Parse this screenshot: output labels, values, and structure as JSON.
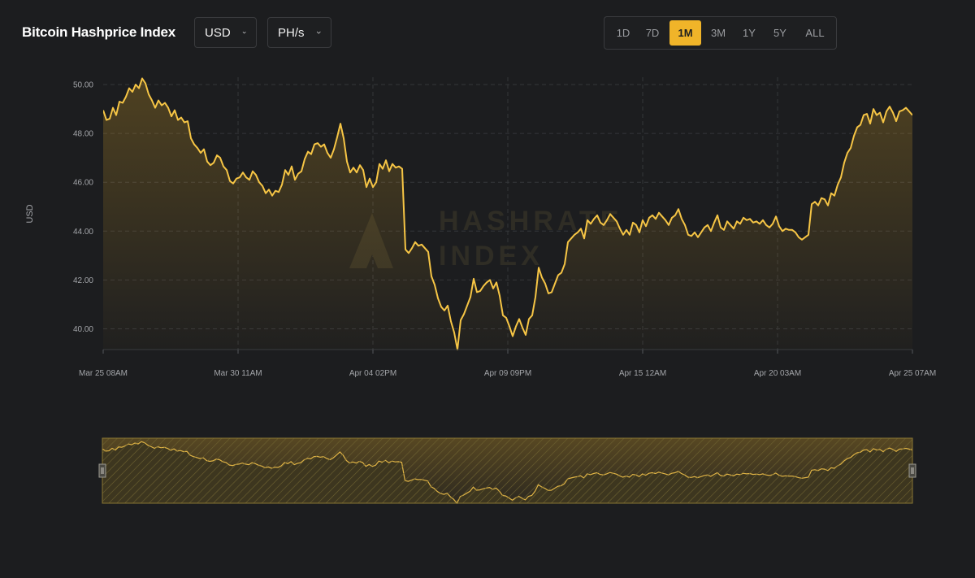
{
  "header": {
    "title": "Bitcoin Hashprice Index",
    "currency": "USD",
    "unit": "PH/s",
    "ranges": [
      "1D",
      "7D",
      "1M",
      "3M",
      "1Y",
      "5Y",
      "ALL"
    ],
    "active_range": "1M"
  },
  "watermark": {
    "line1": "HASHRATE",
    "line2": "INDEX"
  },
  "colors": {
    "line": "#f6c545",
    "accent": "#f0b429",
    "background": "#1c1d1f"
  },
  "chart_data": {
    "type": "area",
    "ylabel": "USD",
    "ylim": [
      39.15,
      50.3
    ],
    "yticks": [
      "40.00",
      "42.00",
      "44.00",
      "46.00",
      "48.00",
      "50.00"
    ],
    "xtick_labels": [
      "Mar 25 08AM",
      "Mar 30 11AM",
      "Apr 04 02PM",
      "Apr 09 09PM",
      "Apr 15 12AM",
      "Apr 20 03AM",
      "Apr 25 07AM"
    ],
    "x_start": "Mar 25 08AM",
    "x_end": "Apr 25 07AM",
    "grid": true,
    "series": [
      {
        "values": [
          48.95,
          48.55,
          48.6,
          49.05,
          48.75,
          49.3,
          49.25,
          49.5,
          49.85,
          49.7,
          50.0,
          49.85,
          50.25,
          50.05,
          49.6,
          49.35,
          49.05,
          49.35,
          49.15,
          49.25,
          49.05,
          48.7,
          48.95,
          48.55,
          48.65,
          48.45,
          48.5,
          47.8,
          47.55,
          47.4,
          47.2,
          47.35,
          46.85,
          46.7,
          46.8,
          47.1,
          47.0,
          46.65,
          46.5,
          46.05,
          45.95,
          46.15,
          46.2,
          46.4,
          46.2,
          46.1,
          46.45,
          46.3,
          46.0,
          45.85,
          45.55,
          45.7,
          45.45,
          45.65,
          45.6,
          45.9,
          46.5,
          46.3,
          46.65,
          46.1,
          46.35,
          46.45,
          46.95,
          47.25,
          47.15,
          47.55,
          47.6,
          47.45,
          47.55,
          47.2,
          47.0,
          47.35,
          47.85,
          48.4,
          47.8,
          46.85,
          46.4,
          46.6,
          46.4,
          46.7,
          46.5,
          45.8,
          46.15,
          45.8,
          46.0,
          46.75,
          46.55,
          46.9,
          46.45,
          46.75,
          46.6,
          46.65,
          46.55,
          43.25,
          43.1,
          43.3,
          43.55,
          43.4,
          43.45,
          43.3,
          43.15,
          42.15,
          41.8,
          41.25,
          40.9,
          40.75,
          40.95,
          40.3,
          39.85,
          39.15,
          40.35,
          40.6,
          40.95,
          41.3,
          42.05,
          41.5,
          41.55,
          41.75,
          41.9,
          42.0,
          41.65,
          41.9,
          41.35,
          40.55,
          40.45,
          40.1,
          39.7,
          40.1,
          40.4,
          40.05,
          39.75,
          40.4,
          40.55,
          41.3,
          42.5,
          42.1,
          41.85,
          41.45,
          41.5,
          41.85,
          42.2,
          42.3,
          42.65,
          43.55,
          43.7,
          43.85,
          43.95,
          44.1,
          43.7,
          44.45,
          44.3,
          44.5,
          44.65,
          44.35,
          44.25,
          44.45,
          44.7,
          44.55,
          44.4,
          44.1,
          43.85,
          44.05,
          43.85,
          44.35,
          44.25,
          43.95,
          44.45,
          44.2,
          44.55,
          44.65,
          44.5,
          44.75,
          44.6,
          44.45,
          44.25,
          44.55,
          44.65,
          44.9,
          44.5,
          44.25,
          43.85,
          43.8,
          43.95,
          43.75,
          43.95,
          44.15,
          44.25,
          44.0,
          44.35,
          44.65,
          44.15,
          44.05,
          44.4,
          44.25,
          44.1,
          44.4,
          44.3,
          44.55,
          44.45,
          44.5,
          44.35,
          44.4,
          44.3,
          44.45,
          44.25,
          44.15,
          44.3,
          44.6,
          44.2,
          44.0,
          44.1,
          44.05,
          44.05,
          43.95,
          43.75,
          43.65,
          43.75,
          43.85,
          45.1,
          45.2,
          45.05,
          45.35,
          45.3,
          45.05,
          45.55,
          45.45,
          45.9,
          46.2,
          46.8,
          47.2,
          47.4,
          47.9,
          48.25,
          48.35,
          48.75,
          48.8,
          48.4,
          49.0,
          48.75,
          48.85,
          48.45,
          48.9,
          49.1,
          48.85,
          48.5,
          48.9,
          48.95,
          49.05,
          48.9,
          48.75
        ]
      }
    ]
  }
}
